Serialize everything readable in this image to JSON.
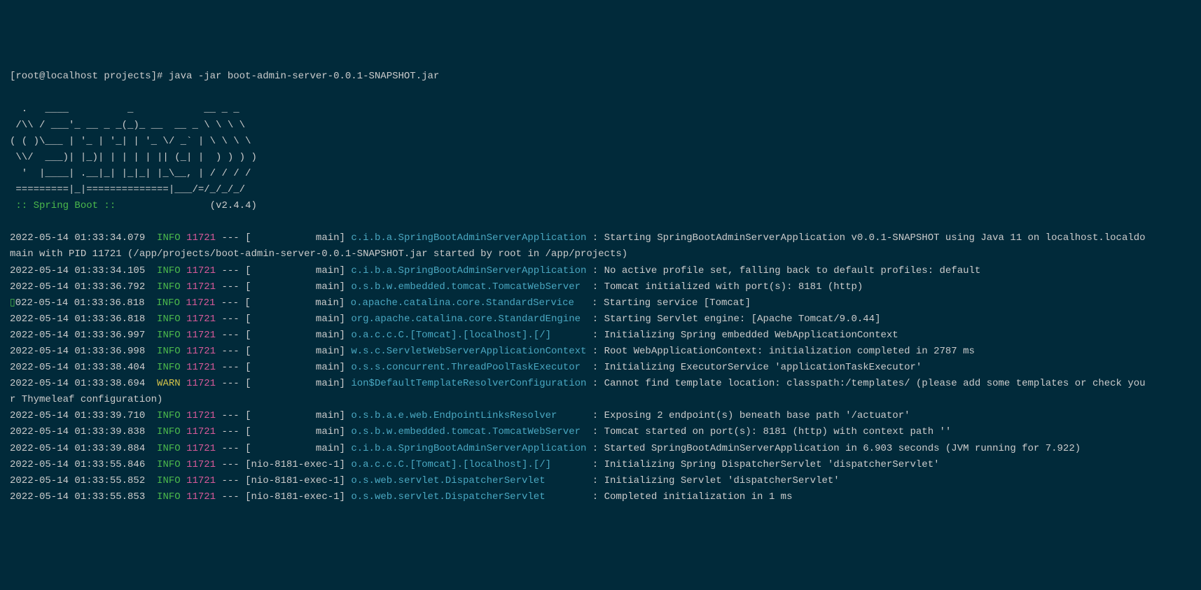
{
  "prompt": "[root@localhost projects]# java -jar boot-admin-server-0.0.1-SNAPSHOT.jar",
  "ascii": {
    "l1": "  .   ____          _            __ _ _",
    "l2": " /\\\\ / ___'_ __ _ _(_)_ __  __ _ \\ \\ \\ \\",
    "l3": "( ( )\\___ | '_ | '_| | '_ \\/ _` | \\ \\ \\ \\",
    "l4": " \\\\/  ___)| |_)| | | | | || (_| |  ) ) ) )",
    "l5": "  '  |____| .__|_| |_|_| |_\\__, | / / / /",
    "l6": " =========|_|==============|___/=/_/_/_/"
  },
  "spring_label": " :: Spring Boot :: ",
  "spring_version": "               (v2.4.4)",
  "logs": [
    {
      "ts": "2022-05-14 01:33:34.079",
      "level": "INFO",
      "pid": "11721",
      "thread": "           main",
      "logger": "c.i.b.a.SpringBootAdminServerApplication",
      "msg": "Starting SpringBootAdminServerApplication v0.0.1-SNAPSHOT using Java 11 on localhost.localdo"
    },
    {
      "cont": "main with PID 11721 (/app/projects/boot-admin-server-0.0.1-SNAPSHOT.jar started by root in /app/projects)"
    },
    {
      "ts": "2022-05-14 01:33:34.105",
      "level": "INFO",
      "pid": "11721",
      "thread": "           main",
      "logger": "c.i.b.a.SpringBootAdminServerApplication",
      "msg": "No active profile set, falling back to default profiles: default"
    },
    {
      "ts": "2022-05-14 01:33:36.792",
      "level": "INFO",
      "pid": "11721",
      "thread": "           main",
      "logger": "o.s.b.w.embedded.tomcat.TomcatWebServer ",
      "msg": "Tomcat initialized with port(s): 8181 (http)"
    },
    {
      "cursor": true,
      "ts": "2022-05-14 01:33:36.818",
      "level": "INFO",
      "pid": "11721",
      "thread": "           main",
      "logger": "o.apache.catalina.core.StandardService  ",
      "msg": "Starting service [Tomcat]"
    },
    {
      "ts": "2022-05-14 01:33:36.818",
      "level": "INFO",
      "pid": "11721",
      "thread": "           main",
      "logger": "org.apache.catalina.core.StandardEngine ",
      "msg": "Starting Servlet engine: [Apache Tomcat/9.0.44]"
    },
    {
      "ts": "2022-05-14 01:33:36.997",
      "level": "INFO",
      "pid": "11721",
      "thread": "           main",
      "logger": "o.a.c.c.C.[Tomcat].[localhost].[/]      ",
      "msg": "Initializing Spring embedded WebApplicationContext"
    },
    {
      "ts": "2022-05-14 01:33:36.998",
      "level": "INFO",
      "pid": "11721",
      "thread": "           main",
      "logger": "w.s.c.ServletWebServerApplicationContext",
      "msg": "Root WebApplicationContext: initialization completed in 2787 ms"
    },
    {
      "ts": "2022-05-14 01:33:38.404",
      "level": "INFO",
      "pid": "11721",
      "thread": "           main",
      "logger": "o.s.s.concurrent.ThreadPoolTaskExecutor ",
      "msg": "Initializing ExecutorService 'applicationTaskExecutor'"
    },
    {
      "ts": "2022-05-14 01:33:38.694",
      "level": "WARN",
      "pid": "11721",
      "thread": "           main",
      "logger": "ion$DefaultTemplateResolverConfiguration",
      "msg": "Cannot find template location: classpath:/templates/ (please add some templates or check you"
    },
    {
      "cont": "r Thymeleaf configuration)"
    },
    {
      "ts": "2022-05-14 01:33:39.710",
      "level": "INFO",
      "pid": "11721",
      "thread": "           main",
      "logger": "o.s.b.a.e.web.EndpointLinksResolver     ",
      "msg": "Exposing 2 endpoint(s) beneath base path '/actuator'"
    },
    {
      "ts": "2022-05-14 01:33:39.838",
      "level": "INFO",
      "pid": "11721",
      "thread": "           main",
      "logger": "o.s.b.w.embedded.tomcat.TomcatWebServer ",
      "msg": "Tomcat started on port(s): 8181 (http) with context path ''"
    },
    {
      "ts": "2022-05-14 01:33:39.884",
      "level": "INFO",
      "pid": "11721",
      "thread": "           main",
      "logger": "c.i.b.a.SpringBootAdminServerApplication",
      "msg": "Started SpringBootAdminServerApplication in 6.903 seconds (JVM running for 7.922)"
    },
    {
      "ts": "2022-05-14 01:33:55.846",
      "level": "INFO",
      "pid": "11721",
      "thread": "nio-8181-exec-1",
      "logger": "o.a.c.c.C.[Tomcat].[localhost].[/]      ",
      "msg": "Initializing Spring DispatcherServlet 'dispatcherServlet'"
    },
    {
      "ts": "2022-05-14 01:33:55.852",
      "level": "INFO",
      "pid": "11721",
      "thread": "nio-8181-exec-1",
      "logger": "o.s.web.servlet.DispatcherServlet       ",
      "msg": "Initializing Servlet 'dispatcherServlet'"
    },
    {
      "ts": "2022-05-14 01:33:55.853",
      "level": "INFO",
      "pid": "11721",
      "thread": "nio-8181-exec-1",
      "logger": "o.s.web.servlet.DispatcherServlet       ",
      "msg": "Completed initialization in 1 ms"
    }
  ]
}
